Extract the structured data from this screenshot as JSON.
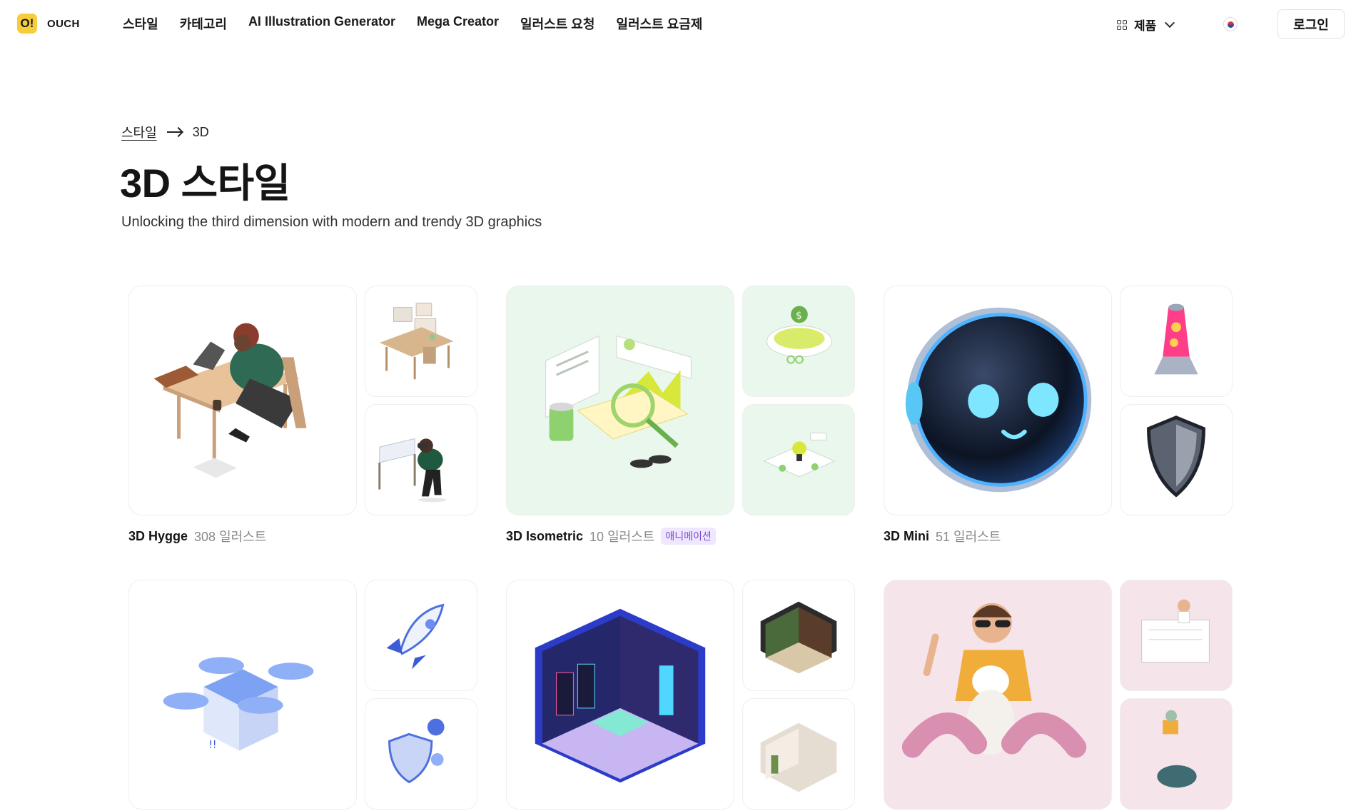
{
  "header": {
    "logo_mark": "O!",
    "logo_text": "OUCH",
    "nav": [
      "스타일",
      "카테고리",
      "AI Illustration Generator",
      "Mega Creator",
      "일러스트 요청",
      "일러스트 요금제"
    ],
    "products_label": "제품",
    "login_label": "로그인"
  },
  "breadcrumb": {
    "parent": "스타일",
    "current": "3D"
  },
  "page": {
    "title": "3D 스타일",
    "subtitle": "Unlocking the third dimension with modern and trendy 3D graphics"
  },
  "styles": [
    {
      "name": "3D Hygge",
      "count": "308 일러스트",
      "badge": ""
    },
    {
      "name": "3D Isometric",
      "count": "10 일러스트",
      "badge": "애니메이션"
    },
    {
      "name": "3D Mini",
      "count": "51 일러스트",
      "badge": ""
    }
  ],
  "colors": {
    "logo": "#f6cd3b",
    "isometric_tile": "#e9f7ec",
    "pink_tile": "#f5e4ea",
    "badge_text": "#7b47d6",
    "badge_bg": "#efe7ff"
  }
}
